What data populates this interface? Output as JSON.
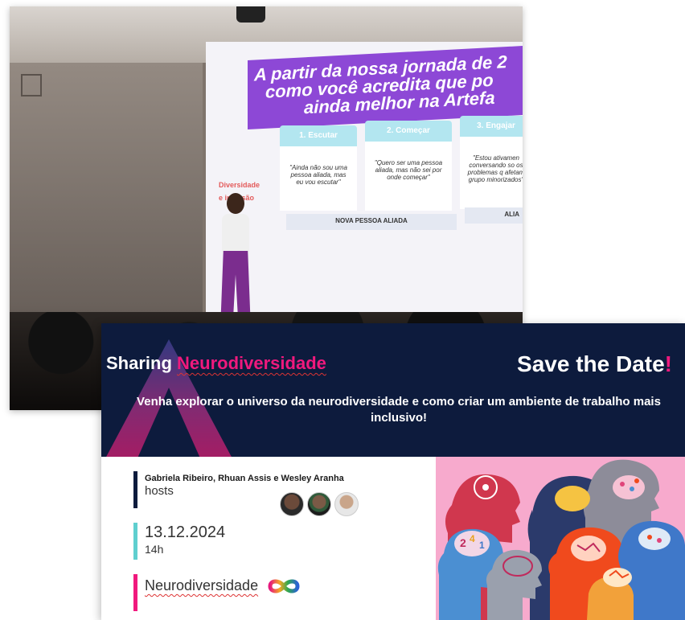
{
  "photo": {
    "slide": {
      "title_lines": [
        "A partir da nossa jornada de 2",
        "como você acredita que po",
        "ainda melhor na Artefa"
      ],
      "label_lines": [
        "Diversidade",
        "e inclusão"
      ],
      "columns": [
        {
          "header": "1. Escutar",
          "quote": "\"Ainda não sou uma pessoa aliada, mas eu vou escutar\""
        },
        {
          "header": "2. Começar",
          "quote": "\"Quero ser uma pessoa aliada, mas não sei por onde começar\""
        },
        {
          "header": "3. Engajar",
          "quote": "\"Estou ativamen conversando so os problemas q afetam grupo minorizados\""
        }
      ],
      "strip_left": "NOVA PESSOA ALIADA",
      "strip_right": "ALIA"
    }
  },
  "banner": {
    "brand_prefix": "Sharing",
    "brand_accent": "Neurodiversidade",
    "save_text": "Save the Date",
    "save_bang": "!",
    "tagline": "Venha explorar o universo da neurodiversidade e como criar um ambiente de trabalho mais inclusivo!",
    "hosts_names": "Gabriela Ribeiro, Rhuan Assis e Wesley Aranha",
    "hosts_label": "hosts",
    "date": "13.12.2024",
    "time": "14h",
    "topic": "Neurodiversidade",
    "colors": {
      "navy": "#0d1b3d",
      "pink": "#f0197d",
      "bar_hosts": "#0d1b3d",
      "bar_date": "#5fcfcf",
      "bar_topic": "#f0197d"
    },
    "icons": [
      "infinity-icon",
      "avatar-gabriela",
      "avatar-rhuan",
      "avatar-wesley"
    ]
  }
}
